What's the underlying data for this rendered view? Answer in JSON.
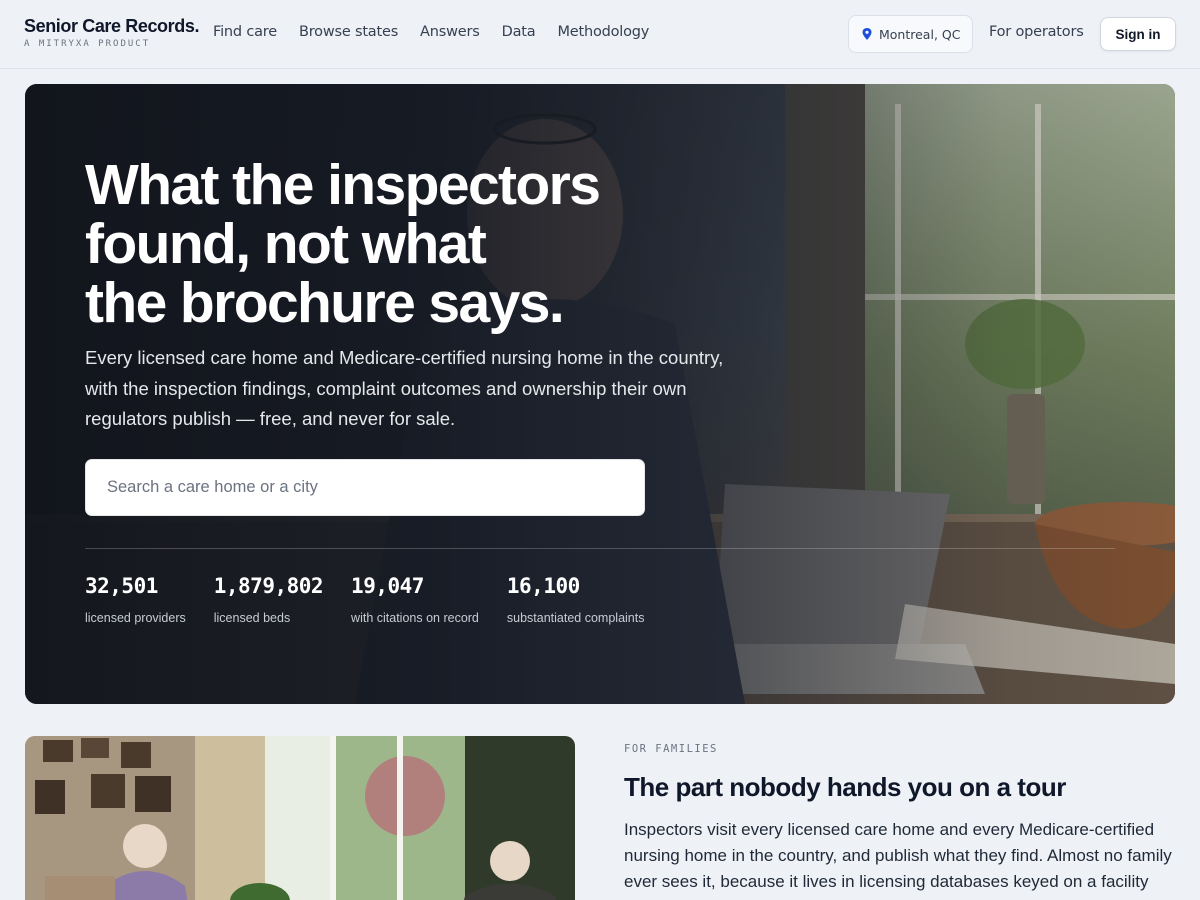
{
  "header": {
    "brand_name": "Senior Care Records.",
    "brand_tag": "A MITRYXA PRODUCT",
    "nav": [
      "Find care",
      "Browse states",
      "Answers",
      "Data",
      "Methodology"
    ],
    "location": "Montreal, QC",
    "operators_link": "For operators",
    "signin_label": "Sign in"
  },
  "hero": {
    "title_lines": [
      "What the inspectors",
      "found, not what",
      "the brochure says."
    ],
    "subtitle": "Every licensed care home and Medicare-certified nursing home in the country, with the inspection findings, complaint outcomes and ownership their own regulators publish — free, and never for sale.",
    "search_placeholder": "Search a care home or a city",
    "stats": [
      {
        "value": "32,501",
        "label": "licensed providers"
      },
      {
        "value": "1,879,802",
        "label": "licensed beds"
      },
      {
        "value": "19,047",
        "label": "with citations on record"
      },
      {
        "value": "16,100",
        "label": "substantiated complaints"
      }
    ]
  },
  "families": {
    "eyebrow": "FOR FAMILIES",
    "title": "The part nobody hands you on a tour",
    "body": "Inspectors visit every licensed care home and every Medicare-certified nursing home in the country, and publish what they find. Almost no family ever sees it, because it lives in licensing databases keyed on a facility"
  },
  "colors": {
    "page_bg": "#eef1f6",
    "brand_text": "#0f172a",
    "pin_accent": "#1d4ed8"
  }
}
